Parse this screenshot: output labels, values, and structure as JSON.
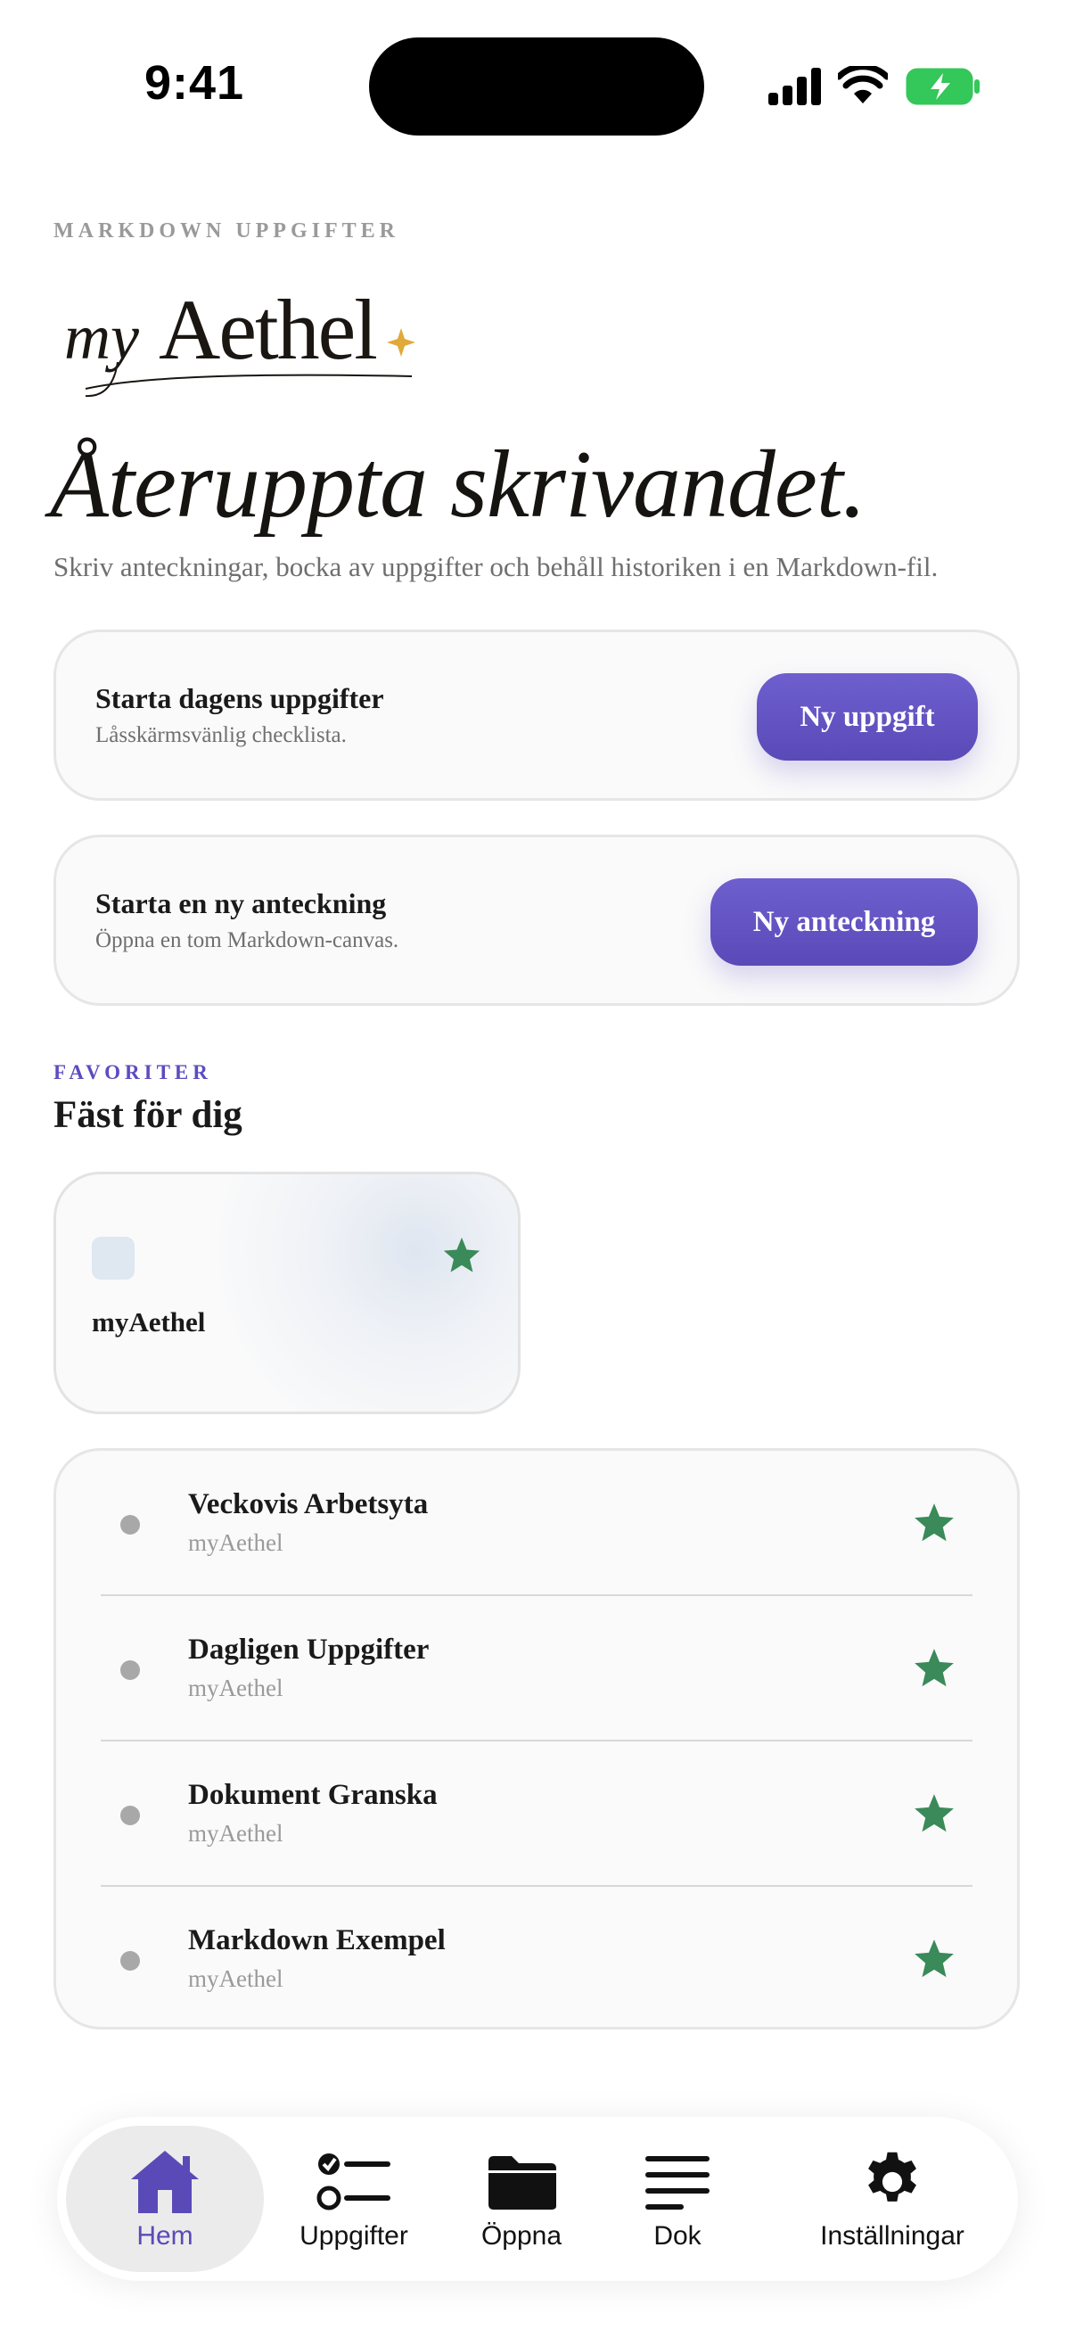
{
  "status_bar": {
    "time": "9:41"
  },
  "header": {
    "eyebrow": "MARKDOWN UPPGIFTER",
    "logo_text": "myAethel",
    "headline": "Återuppta skrivandet.",
    "subtitle": "Skriv anteckningar, bocka av uppgifter och behåll historiken i en Markdown-fil."
  },
  "actions": [
    {
      "title": "Starta dagens uppgifter",
      "subtitle": "Låsskärmsvänlig checklista.",
      "button": "Ny uppgift"
    },
    {
      "title": "Starta en ny anteckning",
      "subtitle": "Öppna en tom Markdown-canvas.",
      "button": "Ny anteckning"
    }
  ],
  "favorites": {
    "eyebrow": "FAVORITER",
    "title": "Fäst för dig",
    "pinned": {
      "label": "myAethel"
    },
    "items": [
      {
        "title": "Veckovis Arbetsyta",
        "subtitle": "myAethel"
      },
      {
        "title": "Dagligen Uppgifter",
        "subtitle": "myAethel"
      },
      {
        "title": "Dokument Granska",
        "subtitle": "myAethel"
      },
      {
        "title": "Markdown Exempel",
        "subtitle": "myAethel"
      }
    ]
  },
  "tabbar": {
    "tabs": [
      {
        "label": "Hem",
        "icon": "house-icon",
        "active": true
      },
      {
        "label": "Uppgifter",
        "icon": "checklist-icon",
        "active": false
      },
      {
        "label": "Öppna",
        "icon": "folder-icon",
        "active": false
      },
      {
        "label": "Dok",
        "icon": "lines-icon",
        "active": false
      },
      {
        "label": "Inställningar",
        "icon": "gear-icon",
        "active": false
      }
    ]
  },
  "colors": {
    "accent": "#5a4ab8",
    "star": "#3a8a5a",
    "battery": "#34c759",
    "logo_star": "#e0a93a"
  }
}
